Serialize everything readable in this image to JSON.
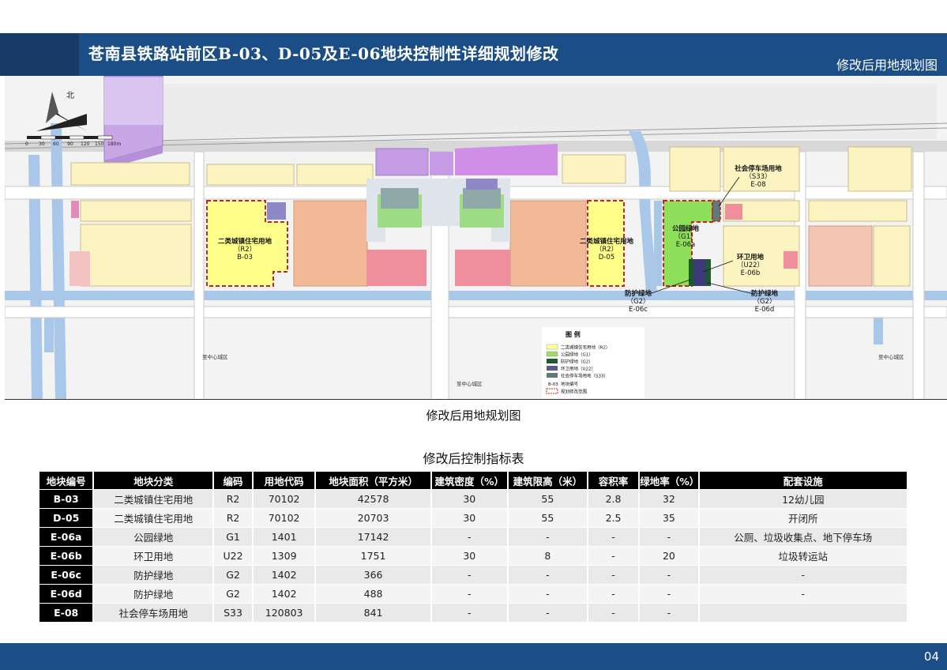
{
  "header": {
    "title": "苍南县铁路站前区B-03、D-05及E-06地块控制性详细规划修改",
    "subtitle": "修改后用地规划图"
  },
  "map": {
    "scale_labels": [
      "0",
      "30",
      "60",
      "90",
      "120",
      "150",
      "180m"
    ],
    "parcels": {
      "b03": {
        "name": "二类城镇住宅用地",
        "code": "（R2）",
        "id": "B-03"
      },
      "d05": {
        "name": "二类城镇住宅用地",
        "code": "（R2）",
        "id": "D-05"
      },
      "e06a": {
        "name": "公园绿地",
        "code": "（G1）",
        "id": "E-06a"
      },
      "e08": {
        "name": "社会停车场用地",
        "code": "（S33）",
        "id": "E-08"
      },
      "e06b": {
        "name": "环卫用地",
        "code": "（U22）",
        "id": "E-06b"
      },
      "e06c": {
        "name": "防护绿地",
        "code": "（G2）",
        "id": "E-06c"
      },
      "e06d": {
        "name": "防护绿地",
        "code": "（G2）",
        "id": "E-06d"
      }
    },
    "place_labels": {
      "west": "至中心城区",
      "center": "至中心城区",
      "east": "至中心城区"
    },
    "legend": {
      "title": "图    例",
      "items": [
        {
          "label": "二类城镇住宅用地（R2）",
          "color": "#ffff99"
        },
        {
          "label": "公园绿地（G1）",
          "color": "#99dd66"
        },
        {
          "label": "防护绿地（G2）",
          "color": "#1f5a2c"
        },
        {
          "label": "环卫用地（U22）",
          "color": "#5a5a8a"
        },
        {
          "label": "社会停车场用地（S33）",
          "color": "#5f7a78"
        }
      ],
      "code_sample": "B-03",
      "code_label": "地块编号",
      "boundary_label": "规划修改范围"
    }
  },
  "map_caption": "修改后用地规划图",
  "table_caption": "修改后控制指标表",
  "table": {
    "headers": [
      "地块编号",
      "地块分类",
      "编码",
      "用地代码",
      "地块面积（平方米）",
      "建筑密度（%）",
      "建筑限高（米）",
      "容积率",
      "绿地率（%）",
      "配套设施"
    ],
    "rows": [
      [
        "B-03",
        "二类城镇住宅用地",
        "R2",
        "70102",
        "42578",
        "30",
        "55",
        "2.8",
        "32",
        "12幼儿园"
      ],
      [
        "D-05",
        "二类城镇住宅用地",
        "R2",
        "70102",
        "20703",
        "30",
        "55",
        "2.5",
        "35",
        "开闭所"
      ],
      [
        "E-06a",
        "公园绿地",
        "G1",
        "1401",
        "17142",
        "-",
        "-",
        "-",
        "-",
        "公厕、垃圾收集点、地下停车场"
      ],
      [
        "E-06b",
        "环卫用地",
        "U22",
        "1309",
        "1751",
        "30",
        "8",
        "-",
        "20",
        "垃圾转运站"
      ],
      [
        "E-06c",
        "防护绿地",
        "G2",
        "1402",
        "366",
        "-",
        "-",
        "-",
        "-",
        "-"
      ],
      [
        "E-06d",
        "防护绿地",
        "G2",
        "1402",
        "488",
        "-",
        "-",
        "-",
        "-",
        "-"
      ],
      [
        "E-08",
        "社会停车场用地",
        "S33",
        "120803",
        "841",
        "-",
        "-",
        "-",
        "-",
        ""
      ]
    ]
  },
  "footer": {
    "page": "04"
  }
}
